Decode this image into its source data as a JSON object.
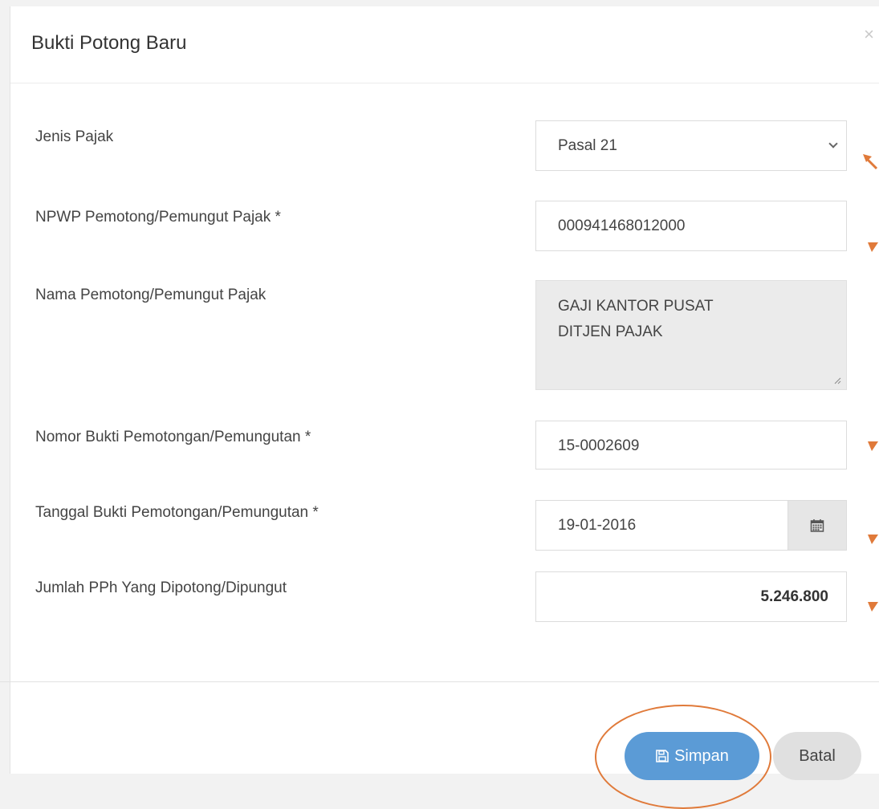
{
  "modal": {
    "title": "Bukti Potong Baru",
    "close_symbol": "×"
  },
  "form": {
    "jenis_pajak": {
      "label": "Jenis Pajak",
      "value": "Pasal 21"
    },
    "npwp": {
      "label": "NPWP Pemotong/Pemungut Pajak *",
      "value": "000941468012000"
    },
    "nama": {
      "label": "Nama Pemotong/Pemungut Pajak",
      "line1": "GAJI KANTOR PUSAT",
      "line2": "DITJEN PAJAK"
    },
    "nomor": {
      "label": "Nomor Bukti Pemotongan/Pemungutan *",
      "value": "15-0002609"
    },
    "tanggal": {
      "label": "Tanggal Bukti Pemotongan/Pemungutan *",
      "value": "19-01-2016"
    },
    "jumlah": {
      "label": "Jumlah PPh Yang Dipotong/Dipungut",
      "value": "5.246.800"
    }
  },
  "footer": {
    "save_label": "Simpan",
    "cancel_label": "Batal"
  },
  "icons": {
    "save": "save-icon",
    "calendar": "calendar-icon",
    "dropdown": "chevron-down-icon"
  },
  "colors": {
    "primary_button": "#5b9bd6",
    "annotation": "#e07a3a",
    "readonly_field": "#ebebeb"
  }
}
